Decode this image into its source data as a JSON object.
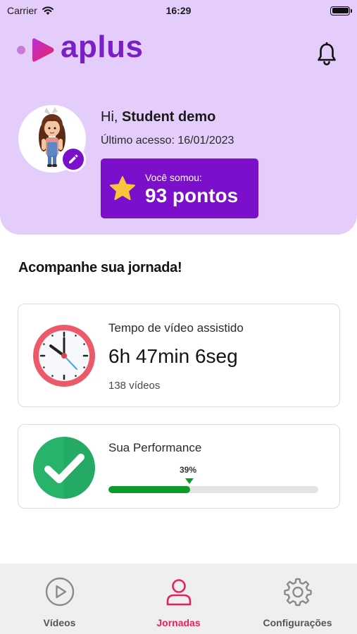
{
  "status_bar": {
    "carrier": "Carrier",
    "time": "16:29"
  },
  "app": {
    "logo_text": "aplus",
    "brand_color": "#7b0fcc"
  },
  "header": {
    "greeting_prefix": "Hi,",
    "user_name": "Student demo",
    "last_access": "Último acesso: 16/01/2023"
  },
  "points": {
    "label": "Você somou:",
    "value": "93 pontos"
  },
  "journey": {
    "title": "Acompanhe sua jornada!",
    "watch_time": {
      "title": "Tempo de vídeo assistido",
      "value": "6h 47min 6seg",
      "count": "138 vídeos"
    },
    "performance": {
      "title": "Sua Performance",
      "percent_label": "39%",
      "percent": 39,
      "bar_color": "#0d9a2b"
    }
  },
  "tabs": [
    {
      "label": "Vídeos",
      "icon": "play-circle-icon",
      "active": false
    },
    {
      "label": "Jornadas",
      "icon": "user-icon",
      "active": true
    },
    {
      "label": "Configurações",
      "icon": "gear-icon",
      "active": false
    }
  ],
  "colors": {
    "header_bg": "#e4cdfa",
    "tab_active": "#e8205e",
    "tab_inactive": "#555555"
  }
}
